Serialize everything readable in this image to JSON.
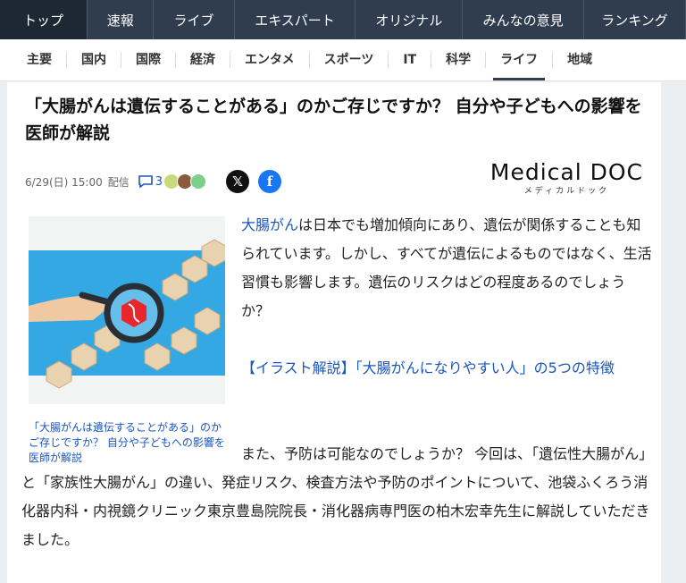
{
  "topnav": [
    "トップ",
    "速報",
    "ライブ",
    "エキスパート",
    "オリジナル",
    "みんなの意見",
    "ランキング"
  ],
  "subnav": [
    "主要",
    "国内",
    "国際",
    "経済",
    "エンタメ",
    "スポーツ",
    "IT",
    "科学",
    "ライフ",
    "地域"
  ],
  "article": {
    "title": "「大腸がんは遺伝することがある」のかご存じですか？ 自分や子どもへの影響を医師が解説",
    "date": "6/29(日) 15:00",
    "delivery": "配信",
    "comment_count": "3",
    "publisher_logo": "Medical DOC",
    "publisher_logo_sub": "メディカルドック",
    "image_caption": "「大腸がんは遺伝することがある」のかご存じですか？ 自分や子どもへの影響を医師が解説",
    "p1_link": "大腸がん",
    "p1_rest": "は日本でも増加傾向にあり、遺伝が関係することも知られています。しかし、すべてが遺伝によるものではなく、生活習慣も影響します。遺伝のリスクはどの程度あるのでしょうか？",
    "p2_link": "【イラスト解説】「大腸がんになりやすい人」の5つの特徴",
    "p3_first": "また、予防は可能なのでしょうか？ 今回は、「遺伝性大腸がん」と「家族性大腸がん」の違い、発症リスク、検査方法や予防のポイントについて、池袋ふくろう消化器内科・内視鏡クリニック東京豊島院院長・消化器病専門医の柏木宏幸先生に解説していただきました。"
  },
  "colors": {
    "nav_bg": "#2f3d4f",
    "link": "#1a56c2",
    "x_brand": "#111111",
    "fb_brand": "#1877f2"
  }
}
